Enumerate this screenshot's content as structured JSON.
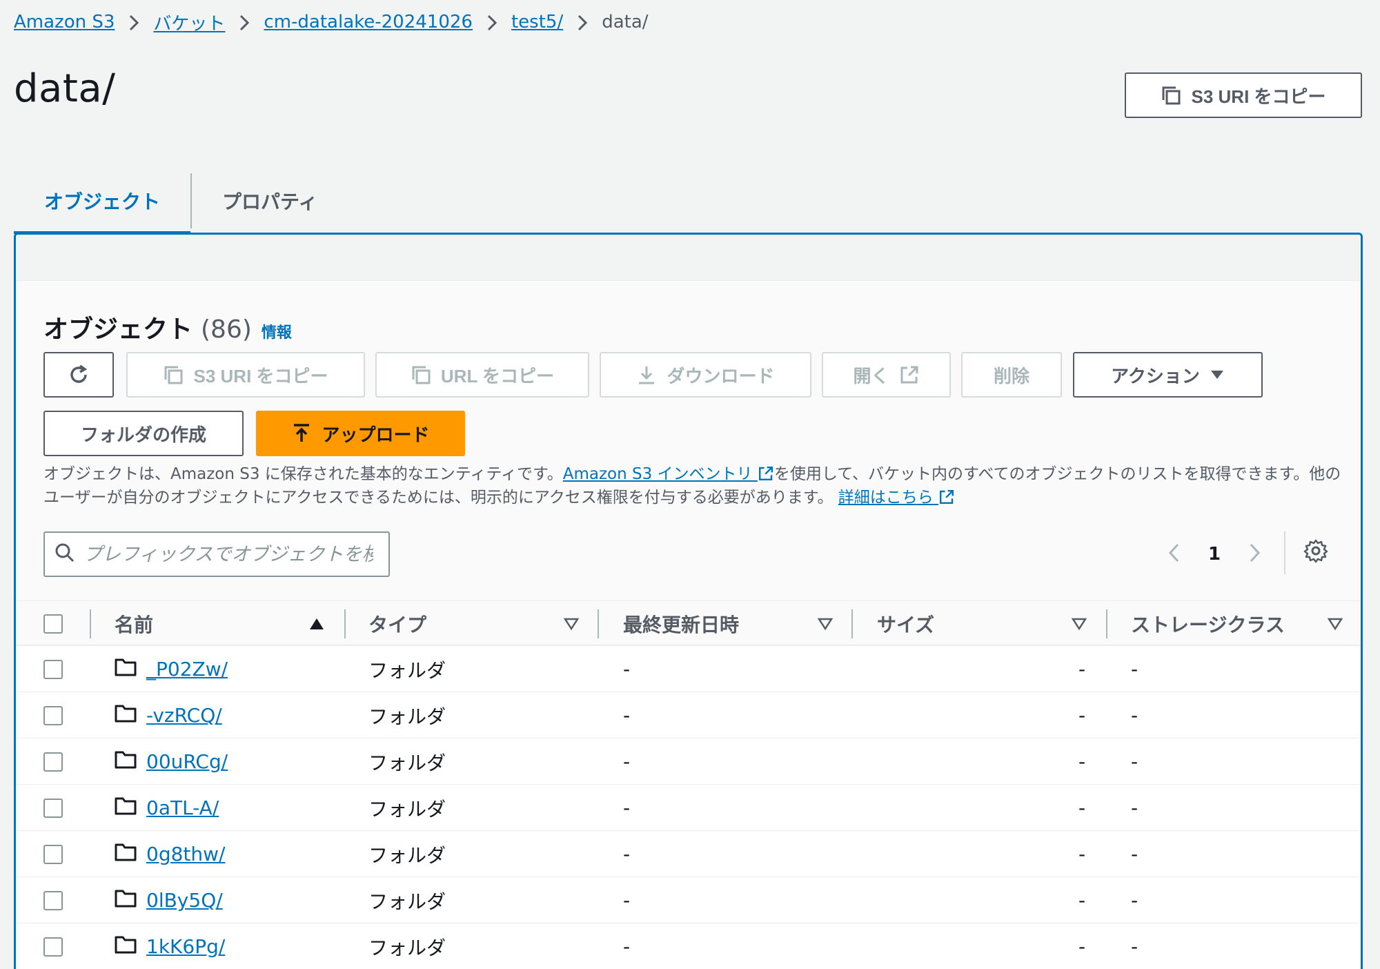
{
  "breadcrumb": {
    "items": [
      {
        "label": "Amazon S3"
      },
      {
        "label": "バケット"
      },
      {
        "label": "cm-datalake-20241026"
      },
      {
        "label": "test5/"
      },
      {
        "label": "data/"
      }
    ]
  },
  "page": {
    "title": "data/",
    "copy_uri_label": "S3 URI をコピー"
  },
  "tabs": [
    {
      "label": "オブジェクト",
      "active": true
    },
    {
      "label": "プロパティ",
      "active": false
    }
  ],
  "objects_panel": {
    "title": "オブジェクト",
    "count": "(86)",
    "info_label": "情報",
    "toolbar": {
      "copy_s3_uri": "S3 URI をコピー",
      "copy_url": "URL をコピー",
      "download": "ダウンロード",
      "open": "開く",
      "delete": "削除",
      "actions": "アクション",
      "create_folder": "フォルダの作成",
      "upload": "アップロード"
    },
    "description": {
      "part1": "オブジェクトは、Amazon S3 に保存された基本的なエンティティです。",
      "inventory_link": "Amazon S3 インベントリ",
      "part2": "を使用して、バケット内のすべてのオブジェクトのリストを取得できます。他のユーザーが自分のオブジェクトにアクセスできるためには、明示的にアクセス権限を付与する必要があります。",
      "details_link": "詳細はこちら"
    },
    "search": {
      "placeholder": "プレフィックスでオブジェクトを検索",
      "value": ""
    },
    "pagination": {
      "current_page": "1"
    }
  },
  "table": {
    "columns": [
      "名前",
      "タイプ",
      "最終更新日時",
      "サイズ",
      "ストレージクラス"
    ],
    "rows": [
      {
        "name": "_P02Zw/",
        "type": "フォルダ",
        "modified": "-",
        "size": "-",
        "storage": "-"
      },
      {
        "name": "-vzRCQ/",
        "type": "フォルダ",
        "modified": "-",
        "size": "-",
        "storage": "-"
      },
      {
        "name": "00uRCg/",
        "type": "フォルダ",
        "modified": "-",
        "size": "-",
        "storage": "-"
      },
      {
        "name": "0aTL-A/",
        "type": "フォルダ",
        "modified": "-",
        "size": "-",
        "storage": "-"
      },
      {
        "name": "0g8thw/",
        "type": "フォルダ",
        "modified": "-",
        "size": "-",
        "storage": "-"
      },
      {
        "name": "0lBy5Q/",
        "type": "フォルダ",
        "modified": "-",
        "size": "-",
        "storage": "-"
      },
      {
        "name": "1kK6Pg/",
        "type": "フォルダ",
        "modified": "-",
        "size": "-",
        "storage": "-"
      }
    ]
  },
  "colors": {
    "link": "#0073bb",
    "primary_button": "#ff9900",
    "background": "#f2f3f3",
    "text": "#16191f",
    "muted_text": "#545b64"
  }
}
